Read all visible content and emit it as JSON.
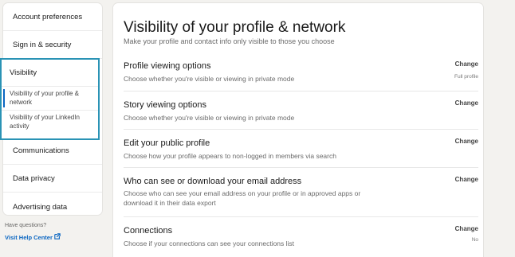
{
  "sidebar": {
    "items_top": [
      {
        "name": "nav-account-preferences",
        "label": "Account preferences"
      },
      {
        "name": "nav-sign-in-security",
        "label": "Sign in & security"
      }
    ],
    "visibility": {
      "label": "Visibility",
      "sub_items": [
        {
          "label": "Visibility of your profile & network",
          "active": true
        },
        {
          "label": "Visibility of your LinkedIn activity",
          "active": false
        }
      ]
    },
    "items_bottom": [
      {
        "name": "nav-communications",
        "label": "Communications"
      },
      {
        "name": "nav-data-privacy",
        "label": "Data privacy"
      },
      {
        "name": "nav-advertising-data",
        "label": "Advertising data"
      }
    ]
  },
  "help": {
    "question": "Have questions?",
    "link": "Visit Help Center"
  },
  "main": {
    "title": "Visibility of your profile & network",
    "subtitle": "Make your profile and contact info only visible to those you choose",
    "settings": [
      {
        "title": "Profile viewing options",
        "desc": "Choose whether you're visible or viewing in private mode",
        "action": "Change",
        "value": "Full profile"
      },
      {
        "title": "Story viewing options",
        "desc": "Choose whether you're visible or viewing in private mode",
        "action": "Change",
        "value": ""
      },
      {
        "title": "Edit your public profile",
        "desc": "Choose how your profile appears to non-logged in members via search",
        "action": "Change",
        "value": ""
      },
      {
        "title": "Who can see or download your email address",
        "desc": "Choose who can see your email address on your profile or in approved apps or download it in their data export",
        "action": "Change",
        "value": ""
      },
      {
        "title": "Connections",
        "desc": "Choose if your connections can see your connections list",
        "action": "Change",
        "value": "No"
      }
    ]
  },
  "colors": {
    "accent": "#0a66c2",
    "focus_outline": "#2a93b5",
    "background": "#f3f2ef"
  }
}
